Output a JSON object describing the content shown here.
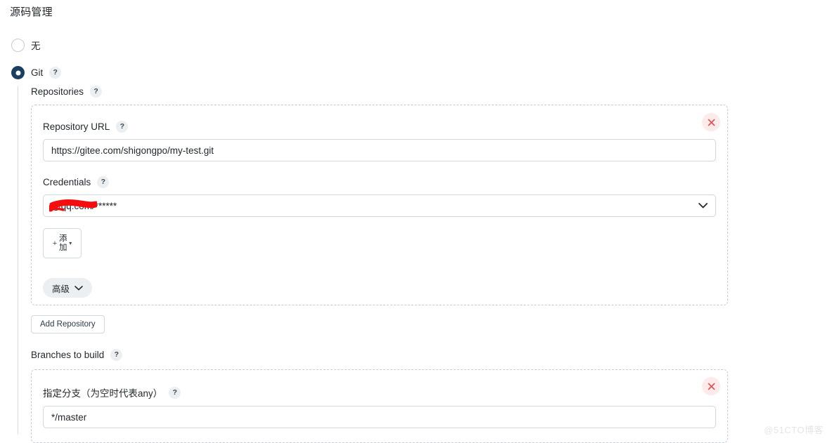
{
  "page": {
    "title": "源码管理",
    "watermark": "@51CTO博客"
  },
  "scm_options": [
    {
      "label": "无",
      "selected": false,
      "has_help": false
    },
    {
      "label": "Git",
      "selected": true,
      "has_help": true
    }
  ],
  "git": {
    "repositories": {
      "label": "Repositories",
      "help": "?",
      "repository_url": {
        "label": "Repository URL",
        "help": "?",
        "value": "https://gitee.com/shigongpo/my-test.git",
        "placeholder": ""
      },
      "credentials": {
        "label": "Credentials",
        "help": "?",
        "selected": "@qq.com/******",
        "redacted": true,
        "caret": "chevron-down"
      },
      "add_credentials_button": {
        "plus": "+",
        "label": "添加",
        "caret": "▾"
      },
      "advanced_button": {
        "label": "高级",
        "caret": "chevron-down"
      },
      "delete_button": {
        "glyph": "×"
      }
    },
    "add_repository_button": {
      "label": "Add Repository"
    },
    "branches": {
      "label": "Branches to build",
      "help": "?",
      "branch_specifier": {
        "label": "指定分支（为空时代表any）",
        "help": "?",
        "value": "*/master",
        "placeholder": ""
      },
      "delete_button": {
        "glyph": "×"
      }
    }
  },
  "colors": {
    "radio_selected": "#1b3f63",
    "delete_bg": "#fdeaea",
    "delete_glyph": "#e05252",
    "redaction": "#f50c0c",
    "dashed_border": "#c3ccd4",
    "input_border": "#cfd8de"
  }
}
